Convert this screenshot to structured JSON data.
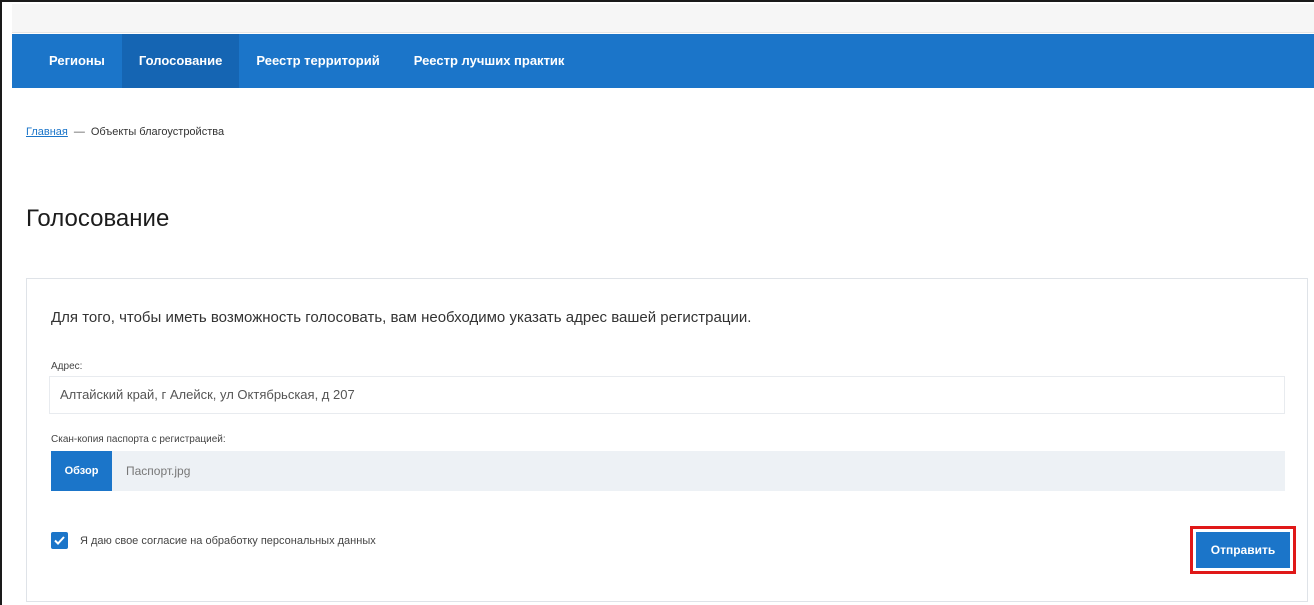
{
  "nav": {
    "items": [
      {
        "label": "Регионы",
        "active": false
      },
      {
        "label": "Голосование",
        "active": true
      },
      {
        "label": "Реестр территорий",
        "active": false
      },
      {
        "label": "Реестр лучших практик",
        "active": false
      }
    ]
  },
  "breadcrumb": {
    "home": "Главная",
    "separator": "—",
    "current": "Объекты благоустройства"
  },
  "page": {
    "title": "Голосование"
  },
  "form": {
    "intro": "Для того, чтобы иметь возможность голосовать, вам необходимо указать адрес вашей регистрации.",
    "address_label": "Адрес:",
    "address_value": "Алтайский край, г Алейск, ул Октябрьская, д 207",
    "scan_label": "Скан-копия паспорта с регистрацией:",
    "browse_label": "Обзор",
    "file_name": "Паспорт.jpg",
    "consent_text": "Я даю свое согласие на обработку персональных данных",
    "consent_checked": true,
    "submit_label": "Отправить"
  },
  "colors": {
    "nav_bg": "#1b75c9",
    "accent": "#1b75c9",
    "highlight": "#e01818"
  }
}
